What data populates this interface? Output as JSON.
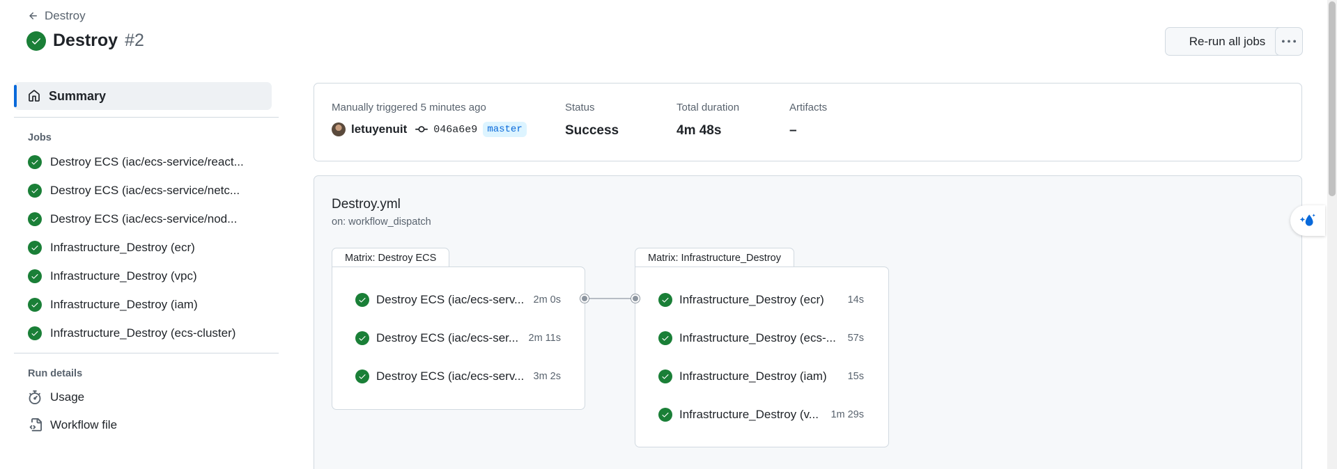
{
  "header": {
    "back_label": "Destroy",
    "title": "Destroy",
    "run_number": "#2",
    "rerun_label": "Re-run all jobs"
  },
  "sidebar": {
    "summary_label": "Summary",
    "jobs_title": "Jobs",
    "jobs": [
      {
        "label": "Destroy ECS (iac/ecs-service/react..."
      },
      {
        "label": "Destroy ECS (iac/ecs-service/netc..."
      },
      {
        "label": "Destroy ECS (iac/ecs-service/nod..."
      },
      {
        "label": "Infrastructure_Destroy (ecr)"
      },
      {
        "label": "Infrastructure_Destroy (vpc)"
      },
      {
        "label": "Infrastructure_Destroy (iam)"
      },
      {
        "label": "Infrastructure_Destroy (ecs-cluster)"
      }
    ],
    "run_details_title": "Run details",
    "usage_label": "Usage",
    "workflow_file_label": "Workflow file"
  },
  "summary": {
    "trigger_text": "Manually triggered 5 minutes ago",
    "actor": "letuyenuit",
    "commit_sha": "046a6e9",
    "branch": "master",
    "status_label": "Status",
    "status_value": "Success",
    "duration_label": "Total duration",
    "duration_value": "4m 48s",
    "artifacts_label": "Artifacts",
    "artifacts_value": "–"
  },
  "workflow": {
    "file_name": "Destroy.yml",
    "trigger": "on: workflow_dispatch",
    "matrix1": {
      "title": "Matrix: Destroy ECS",
      "jobs": [
        {
          "name": "Destroy ECS (iac/ecs-serv...",
          "duration": "2m 0s"
        },
        {
          "name": "Destroy ECS (iac/ecs-ser...",
          "duration": "2m 11s"
        },
        {
          "name": "Destroy ECS (iac/ecs-serv...",
          "duration": "3m 2s"
        }
      ]
    },
    "matrix2": {
      "title": "Matrix: Infrastructure_Destroy",
      "jobs": [
        {
          "name": "Infrastructure_Destroy (ecr)",
          "duration": "14s"
        },
        {
          "name": "Infrastructure_Destroy (ecs-...",
          "duration": "57s"
        },
        {
          "name": "Infrastructure_Destroy (iam)",
          "duration": "15s"
        },
        {
          "name": "Infrastructure_Destroy (v...",
          "duration": "1m 29s"
        }
      ]
    }
  },
  "colors": {
    "success": "#1a7f37",
    "accent": "#0969da"
  },
  "icons": [
    "arrow-left-icon",
    "check-circle-icon",
    "kebab-horizontal-icon",
    "home-icon",
    "stopwatch-icon",
    "file-code-icon",
    "git-commit-icon",
    "copilot-icon"
  ]
}
